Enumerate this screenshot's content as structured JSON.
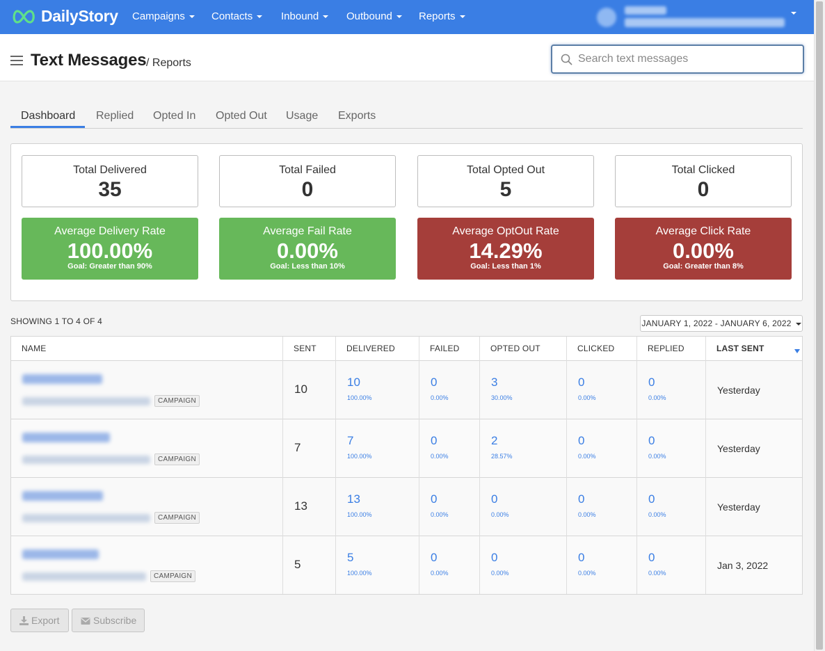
{
  "navbar": {
    "brand": "DailyStory",
    "items": [
      {
        "label": "Campaigns"
      },
      {
        "label": "Contacts"
      },
      {
        "label": "Inbound"
      },
      {
        "label": "Outbound"
      },
      {
        "label": "Reports"
      }
    ]
  },
  "header": {
    "title": "Text Messages",
    "subtitle": "/ Reports",
    "search_placeholder": "Search text messages"
  },
  "tabs": [
    {
      "label": "Dashboard",
      "active": true
    },
    {
      "label": "Replied"
    },
    {
      "label": "Opted In"
    },
    {
      "label": "Opted Out"
    },
    {
      "label": "Usage"
    },
    {
      "label": "Exports"
    }
  ],
  "stats": [
    {
      "label": "Total Delivered",
      "value": "35"
    },
    {
      "label": "Total Failed",
      "value": "0"
    },
    {
      "label": "Total Opted Out",
      "value": "5"
    },
    {
      "label": "Total Clicked",
      "value": "0"
    }
  ],
  "rates": [
    {
      "label": "Average Delivery Rate",
      "value": "100.00%",
      "goal": "Goal: Greater than 90%",
      "color": "#67b85a"
    },
    {
      "label": "Average Fail Rate",
      "value": "0.00%",
      "goal": "Goal: Less than 10%",
      "color": "#67b85a"
    },
    {
      "label": "Average OptOut Rate",
      "value": "14.29%",
      "goal": "Goal: Less than 1%",
      "color": "#a53e3a"
    },
    {
      "label": "Average Click Rate",
      "value": "0.00%",
      "goal": "Goal: Greater than 8%",
      "color": "#a53e3a"
    }
  ],
  "table": {
    "showing": "SHOWING 1 TO 4 OF 4",
    "date_range": "JANUARY 1, 2022 - JANUARY 6, 2022",
    "columns": [
      "NAME",
      "SENT",
      "DELIVERED",
      "FAILED",
      "OPTED OUT",
      "CLICKED",
      "REPLIED",
      "LAST SENT"
    ],
    "badge": "CAMPAIGN",
    "rows": [
      {
        "sent": "10",
        "delivered": "10",
        "delivered_pct": "100.00%",
        "failed": "0",
        "failed_pct": "0.00%",
        "opted_out": "3",
        "opted_out_pct": "30.00%",
        "clicked": "0",
        "clicked_pct": "0.00%",
        "replied": "0",
        "replied_pct": "0.00%",
        "last_sent": "Yesterday"
      },
      {
        "sent": "7",
        "delivered": "7",
        "delivered_pct": "100.00%",
        "failed": "0",
        "failed_pct": "0.00%",
        "opted_out": "2",
        "opted_out_pct": "28.57%",
        "clicked": "0",
        "clicked_pct": "0.00%",
        "replied": "0",
        "replied_pct": "0.00%",
        "last_sent": "Yesterday"
      },
      {
        "sent": "13",
        "delivered": "13",
        "delivered_pct": "100.00%",
        "failed": "0",
        "failed_pct": "0.00%",
        "opted_out": "0",
        "opted_out_pct": "0.00%",
        "clicked": "0",
        "clicked_pct": "0.00%",
        "replied": "0",
        "replied_pct": "0.00%",
        "last_sent": "Yesterday"
      },
      {
        "sent": "5",
        "delivered": "5",
        "delivered_pct": "100.00%",
        "failed": "0",
        "failed_pct": "0.00%",
        "opted_out": "0",
        "opted_out_pct": "0.00%",
        "clicked": "0",
        "clicked_pct": "0.00%",
        "replied": "0",
        "replied_pct": "0.00%",
        "last_sent": "Jan 3, 2022"
      }
    ]
  },
  "footer": {
    "export_label": "Export",
    "subscribe_label": "Subscribe"
  }
}
